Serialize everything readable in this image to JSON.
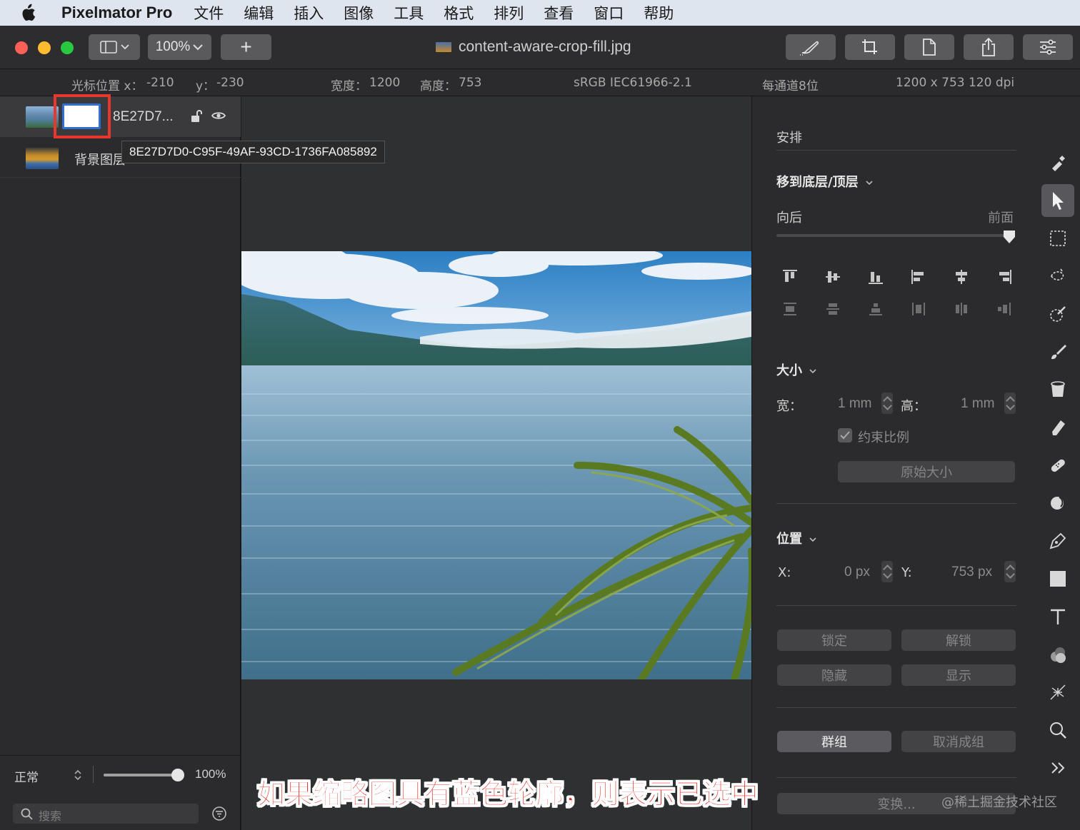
{
  "menubar": {
    "app_name": "Pixelmator Pro",
    "items": [
      "文件",
      "编辑",
      "插入",
      "图像",
      "工具",
      "格式",
      "排列",
      "查看",
      "窗口",
      "帮助"
    ]
  },
  "toolbar": {
    "zoom": "100%",
    "add_label": "+",
    "document_title": "content-aware-crop-fill.jpg",
    "icons": [
      "sidebar-icon",
      "paintbrush-style-icon",
      "crop-icon",
      "page-icon",
      "share-icon",
      "sliders-icon"
    ]
  },
  "infobar": {
    "cursor_label": "光标位置 x：",
    "cursor_x": "-210",
    "y_label": "y：",
    "cursor_y": "-230",
    "width_label": "宽度：",
    "width": "1200",
    "height_label": "高度：",
    "height": "753",
    "color_profile": "sRGB IEC61966-2.1",
    "bit_depth": "每通道8位",
    "dimensions": "1200 x 753 120 dpi"
  },
  "layers": {
    "selected_name": "8E27D7...",
    "background_name": "背景图层",
    "tooltip": "8E27D7D0-C95F-49AF-93CD-1736FA085892",
    "blend_mode": "正常",
    "opacity": "100%",
    "opacity_level": 1.0,
    "search_placeholder": "搜索"
  },
  "canvas": {
    "caption": "如果缩略图具有蓝色轮廓，则表示已选中"
  },
  "inspector": {
    "section_arrange": "安排",
    "move_label": "移到底层/顶层",
    "back_label": "向后",
    "front_label": "前面",
    "arrange_level": 1.0,
    "size_label": "大小",
    "w_label": "宽：",
    "w_value": "1 mm",
    "h_label": "高：",
    "h_value": "1 mm",
    "constrain_label": "约束比例",
    "constrain_checked": true,
    "original_size": "原始大小",
    "position_label": "位置",
    "x_label": "X:",
    "x_value": "0 px",
    "y_label": "Y:",
    "y_value": "753 px",
    "lock": "锁定",
    "unlock": "解锁",
    "hide": "隐藏",
    "show": "显示",
    "group": "群组",
    "ungroup": "取消成组",
    "transform": "变换..."
  },
  "watermark": "@稀土掘金技术社区",
  "colors": {
    "selection_outline": "#2f6fd1",
    "highlight_box": "#e8372c",
    "caption": "#e8231c"
  }
}
